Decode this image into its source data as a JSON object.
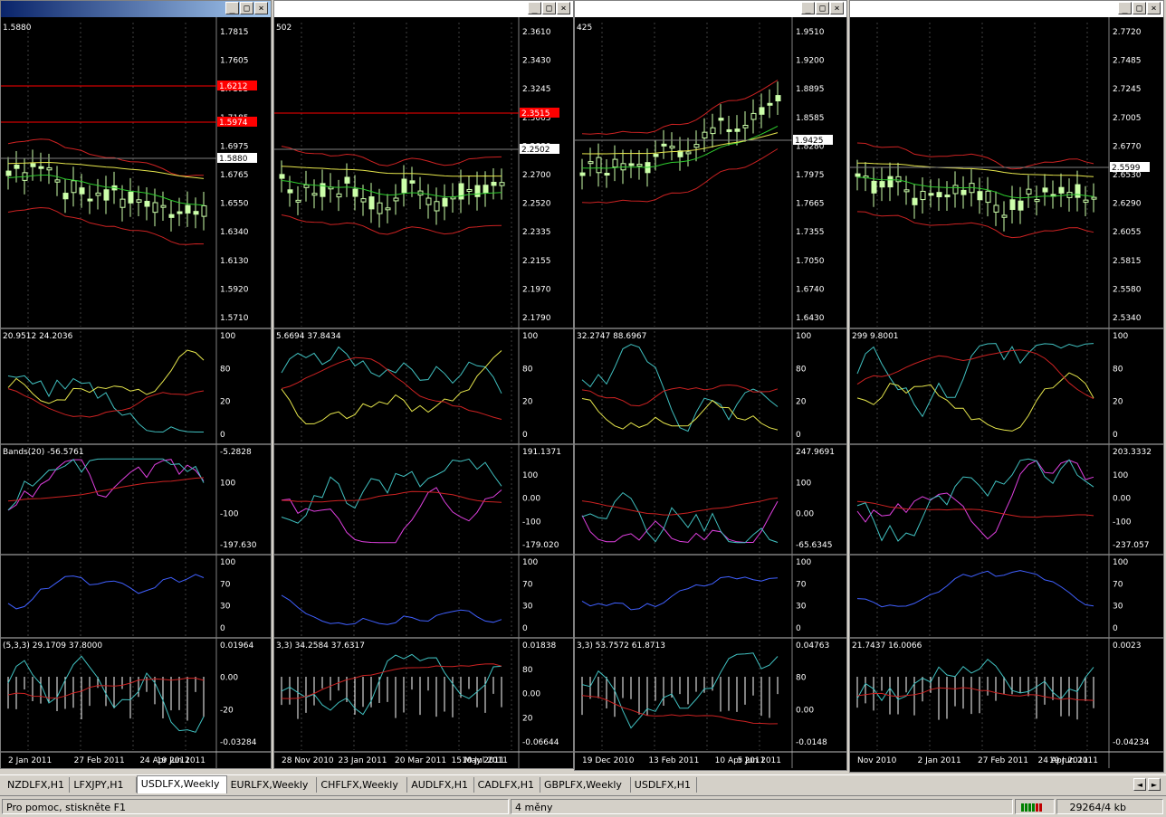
{
  "windows": [
    {
      "id": "w1",
      "top_label": "1.5880",
      "price_labels": [
        "1.7815",
        "1.7605",
        "1.7395",
        "1.7185",
        "1.6975",
        "1.6765",
        "1.6550",
        "1.6340",
        "1.6130",
        "1.5920",
        "1.5710"
      ],
      "highlight_labels": [
        {
          "text": "1.6212",
          "color": "#ff0000"
        },
        {
          "text": "1.5974",
          "color": "#ff0000"
        },
        {
          "text": "1.5880",
          "color": "#ffffff"
        }
      ],
      "stoch_label": "20.9512 24.2036",
      "stoch_scale": [
        "100",
        "80",
        "20",
        "0"
      ],
      "cci_label": "Bands(20) -56.5761",
      "cci_scale": [
        "-5.2828",
        "100",
        "-100",
        "-197.630"
      ],
      "rsi_scale": [
        "100",
        "70",
        "30",
        "0"
      ],
      "macd_label": "(5,3,3) 29.1709 37.8000",
      "macd_scale": [
        "0.01964",
        "0.00",
        "-20",
        "-0.03284"
      ],
      "dates": [
        "2 Jan 2011",
        "27 Feb 2011",
        "24 Apr 2011",
        "19 Jun 2011"
      ]
    },
    {
      "id": "w2",
      "top_label": "502",
      "price_labels": [
        "2.3610",
        "2.3430",
        "2.3245",
        "2.3065",
        "2.2880",
        "2.2700",
        "2.2520",
        "2.2335",
        "2.2155",
        "2.1970",
        "2.1790"
      ],
      "highlight_labels": [
        {
          "text": "2.3515",
          "color": "#ff0000"
        },
        {
          "text": "2.2502",
          "color": "#ffffff"
        }
      ],
      "stoch_label": "5.6694 37.8434",
      "stoch_scale": [
        "100",
        "80",
        "20",
        "0"
      ],
      "cci_label": "",
      "cci_scale": [
        "191.1371",
        "100",
        "0.00",
        "-100",
        "-179.020"
      ],
      "rsi_scale": [
        "100",
        "70",
        "30",
        "0"
      ],
      "macd_label": "3,3) 34.2584 37.6317",
      "macd_scale": [
        "0.01838",
        "80",
        "0.00",
        "20",
        "-0.06644"
      ],
      "dates": [
        "28 Nov 2010",
        "23 Jan 2011",
        "20 Mar 2011",
        "15 May 2011",
        "10 Jul 2011"
      ]
    },
    {
      "id": "w3",
      "top_label": "425",
      "price_labels": [
        "1.9510",
        "1.9200",
        "1.8895",
        "1.8585",
        "1.8280",
        "1.7975",
        "1.7665",
        "1.7355",
        "1.7050",
        "1.6740",
        "1.6430"
      ],
      "highlight_labels": [
        {
          "text": "1.9425",
          "color": "#ffffff"
        }
      ],
      "stoch_label": "32.2747 88.6967",
      "stoch_scale": [
        "100",
        "80",
        "20",
        "0"
      ],
      "cci_label": "",
      "cci_scale": [
        "247.9691",
        "100",
        "0.00",
        "-65.6345"
      ],
      "rsi_scale": [
        "100",
        "70",
        "30",
        "0"
      ],
      "macd_label": "3,3) 53.7572 61.8713",
      "macd_scale": [
        "0.04763",
        "80",
        "0.00",
        "-0.0148"
      ],
      "dates": [
        "19 Dec 2010",
        "13 Feb 2011",
        "10 Apr 2011",
        "5 Jun 2011"
      ]
    },
    {
      "id": "w4",
      "top_label": "",
      "price_labels": [
        "2.7720",
        "2.7485",
        "2.7245",
        "2.7005",
        "2.6770",
        "2.6530",
        "2.6290",
        "2.6055",
        "2.5815",
        "2.5580",
        "2.5340"
      ],
      "highlight_labels": [
        {
          "text": "2.5599",
          "color": "#ffffff"
        }
      ],
      "stoch_label": "299 9.8001",
      "stoch_scale": [
        "100",
        "80",
        "20",
        "0"
      ],
      "cci_label": "",
      "cci_scale": [
        "203.3332",
        "100",
        "0.00",
        "-100",
        "-237.057"
      ],
      "rsi_scale": [
        "100",
        "70",
        "30",
        "0"
      ],
      "macd_label": "21.7437 16.0066",
      "macd_scale": [
        "0.0023",
        "-0.04234"
      ],
      "dates": [
        "Nov 2010",
        "2 Jan 2011",
        "27 Feb 2011",
        "24 Apr 2011",
        "19 Jun 2011"
      ]
    }
  ],
  "window_buttons": {
    "minimize": "_",
    "maximize": "□",
    "close": "×"
  },
  "tabs": [
    "NZDLFX,H1",
    "LFXJPY,H1",
    "USDLFX,Weekly",
    "EURLFX,Weekly",
    "CHFLFX,Weekly",
    "AUDLFX,H1",
    "CADLFX,H1",
    "GBPLFX,Weekly",
    "USDLFX,H1"
  ],
  "active_tab": 2,
  "tab_nav": {
    "left": "◄",
    "right": "►"
  },
  "status": {
    "help": "Pro pomoc, stiskněte F1",
    "profile": "4 měny",
    "traffic": "29264/4 kb"
  },
  "colors": {
    "background": "#000000",
    "bull_candle": "#ccffaa",
    "ma_yellow": "#e6e64c",
    "ma_green": "#2ecc2e",
    "band_red": "#cc2222",
    "stoch_main": "#e6e64c",
    "stoch_aqua": "#40c0c0",
    "cci_magenta": "#e040e0",
    "rsi_blue": "#4060ff"
  }
}
